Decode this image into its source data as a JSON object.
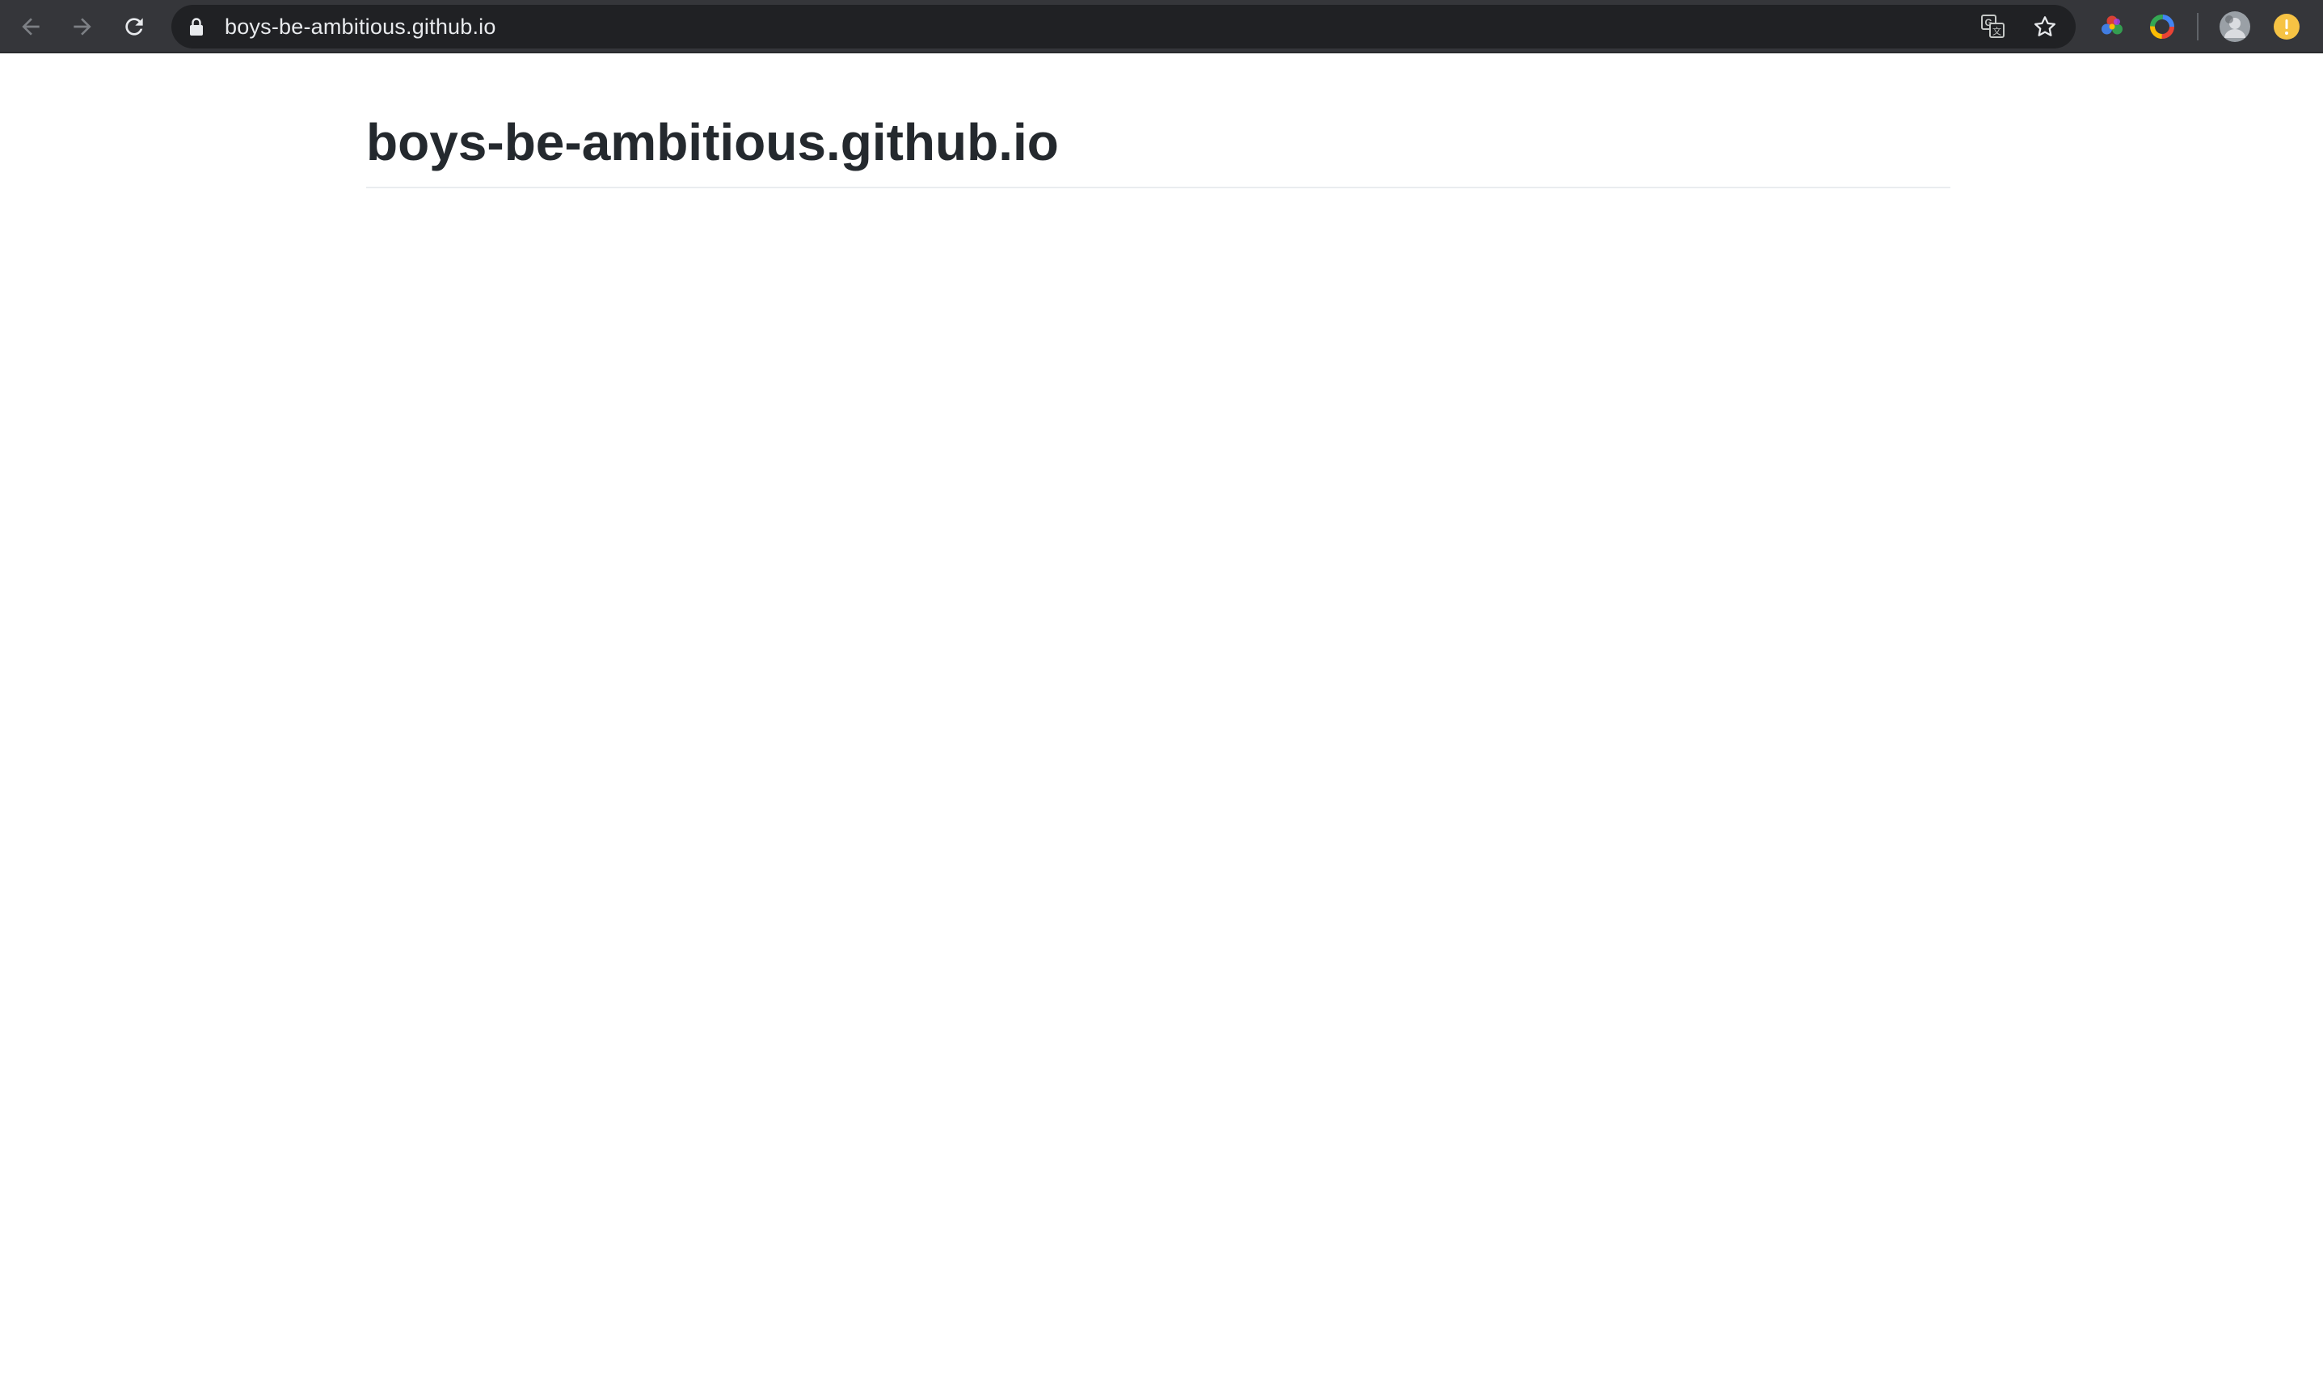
{
  "browser": {
    "url": "boys-be-ambitious.github.io",
    "icons": {
      "back": "arrow-left-icon",
      "forward": "arrow-right-icon",
      "reload": "reload-icon",
      "lock": "lock-icon",
      "translate": "translate-icon",
      "bookmark": "star-icon",
      "extension_1": "color-wheel-extension-icon",
      "extension_2": "color-ring-extension-icon",
      "profile": "profile-avatar-icon",
      "status": "update-available-icon"
    },
    "colors": {
      "toolbar": "#35363a",
      "omnibox": "#202124",
      "url_text": "#e8eaed",
      "status_badge": "#f6c344"
    }
  },
  "page": {
    "title": "boys-be-ambitious.github.io",
    "colors": {
      "title": "#24292e",
      "rule": "#eaecef"
    }
  }
}
